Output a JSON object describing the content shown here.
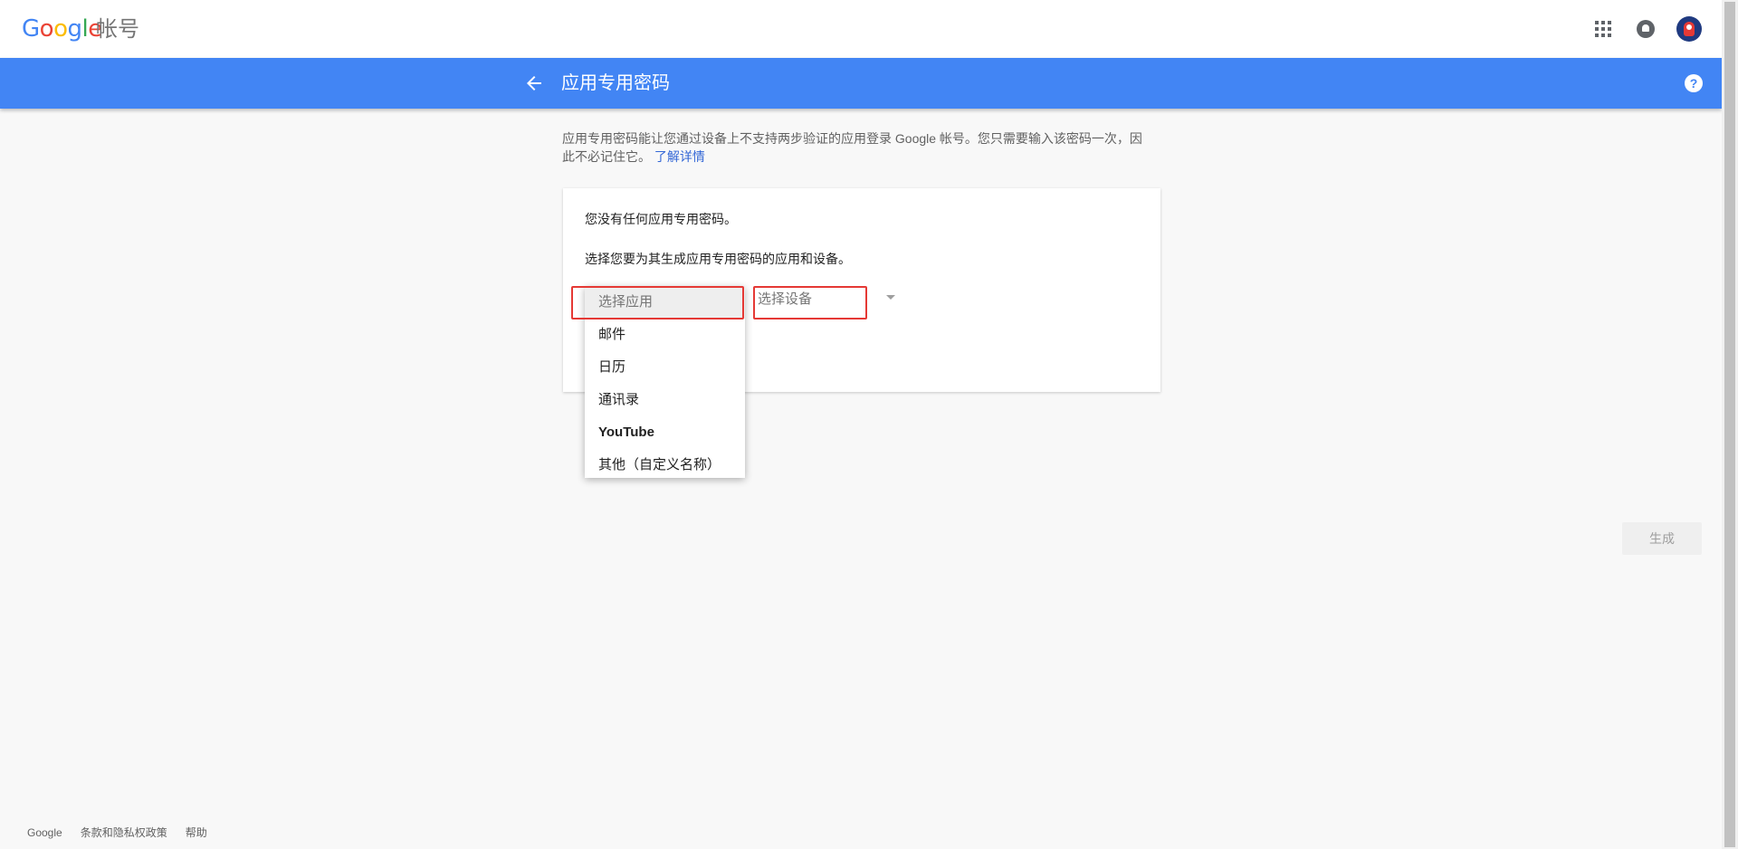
{
  "header": {
    "logo_letters": [
      "G",
      "o",
      "o",
      "g",
      "l",
      "e"
    ],
    "logo_suffix": "帐号"
  },
  "title_bar": {
    "title": "应用专用密码",
    "help_glyph": "?"
  },
  "intro": {
    "text": "应用专用密码能让您通过设备上不支持两步验证的应用登录 Google 帐号。您只需要输入该密码一次，因此不必记住它。",
    "link": "了解详情"
  },
  "card": {
    "no_passwords": "您没有任何应用专用密码。",
    "instruction": "选择您要为其生成应用专用密码的应用和设备。",
    "device_placeholder": "选择设备",
    "generate_label": "生成"
  },
  "app_dropdown": {
    "options": [
      {
        "label": "选择应用"
      },
      {
        "label": "邮件"
      },
      {
        "label": "日历"
      },
      {
        "label": "通讯录"
      },
      {
        "label": "YouTube"
      },
      {
        "label": "其他（自定义名称）"
      }
    ]
  },
  "footer": {
    "links": [
      "Google",
      "条款和隐私权政策",
      "帮助"
    ]
  }
}
